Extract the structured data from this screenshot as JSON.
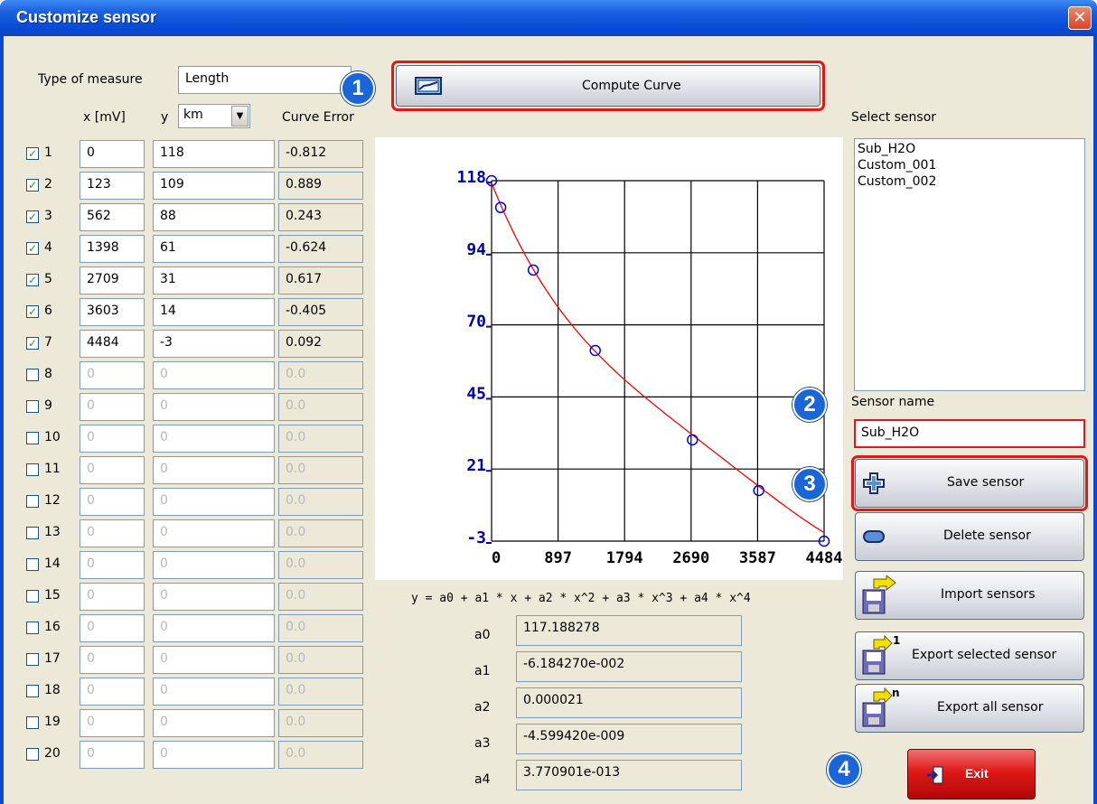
{
  "window": {
    "title": "Customize sensor",
    "close_glyph": "✕"
  },
  "measure": {
    "label": "Type of measure",
    "value": "Length"
  },
  "headers": {
    "x": "x [mV]",
    "y": "y",
    "unit": "km",
    "err": "Curve Error"
  },
  "rows": [
    {
      "n": "1",
      "checked": true,
      "x": "0",
      "y": "118",
      "err": "-0.812"
    },
    {
      "n": "2",
      "checked": true,
      "x": "123",
      "y": "109",
      "err": "0.889"
    },
    {
      "n": "3",
      "checked": true,
      "x": "562",
      "y": "88",
      "err": "0.243"
    },
    {
      "n": "4",
      "checked": true,
      "x": "1398",
      "y": "61",
      "err": "-0.624"
    },
    {
      "n": "5",
      "checked": true,
      "x": "2709",
      "y": "31",
      "err": "0.617"
    },
    {
      "n": "6",
      "checked": true,
      "x": "3603",
      "y": "14",
      "err": "-0.405"
    },
    {
      "n": "7",
      "checked": true,
      "x": "4484",
      "y": "-3",
      "err": "0.092"
    },
    {
      "n": "8",
      "checked": false,
      "x": "0",
      "y": "0",
      "err": "0.0"
    },
    {
      "n": "9",
      "checked": false,
      "x": "0",
      "y": "0",
      "err": "0.0"
    },
    {
      "n": "10",
      "checked": false,
      "x": "0",
      "y": "0",
      "err": "0.0"
    },
    {
      "n": "11",
      "checked": false,
      "x": "0",
      "y": "0",
      "err": "0.0"
    },
    {
      "n": "12",
      "checked": false,
      "x": "0",
      "y": "0",
      "err": "0.0"
    },
    {
      "n": "13",
      "checked": false,
      "x": "0",
      "y": "0",
      "err": "0.0"
    },
    {
      "n": "14",
      "checked": false,
      "x": "0",
      "y": "0",
      "err": "0.0"
    },
    {
      "n": "15",
      "checked": false,
      "x": "0",
      "y": "0",
      "err": "0.0"
    },
    {
      "n": "16",
      "checked": false,
      "x": "0",
      "y": "0",
      "err": "0.0"
    },
    {
      "n": "17",
      "checked": false,
      "x": "0",
      "y": "0",
      "err": "0.0"
    },
    {
      "n": "18",
      "checked": false,
      "x": "0",
      "y": "0",
      "err": "0.0"
    },
    {
      "n": "19",
      "checked": false,
      "x": "0",
      "y": "0",
      "err": "0.0"
    },
    {
      "n": "20",
      "checked": false,
      "x": "0",
      "y": "0",
      "err": "0.0"
    }
  ],
  "compute_button": {
    "label": "Compute Curve",
    "icon": "curve-chart-icon"
  },
  "badges": [
    "1",
    "2",
    "3",
    "4"
  ],
  "chart_data": {
    "type": "scatter",
    "x_ticks": [
      "0",
      "897",
      "1794",
      "2690",
      "3587",
      "4484"
    ],
    "y_ticks": [
      "118",
      "94",
      "70",
      "45",
      "21",
      "-3"
    ],
    "xlim": [
      0,
      4484
    ],
    "ylim": [
      -3,
      118
    ],
    "grid": true,
    "points": [
      [
        0,
        118
      ],
      [
        123,
        109
      ],
      [
        562,
        88
      ],
      [
        1398,
        61
      ],
      [
        2709,
        31
      ],
      [
        3603,
        14
      ],
      [
        4484,
        -3
      ]
    ],
    "point_color": "#0000ff",
    "curve_color": "#ff0000",
    "tick_color": "#0000aa",
    "formula": "y = a0 + a1 * x + a2 * x^2 + a3 * x^3 + a4 * x^4"
  },
  "coefficients": [
    {
      "name": "a0",
      "value": "117.188278"
    },
    {
      "name": "a1",
      "value": "-6.184270e-002"
    },
    {
      "name": "a2",
      "value": "0.000021"
    },
    {
      "name": "a3",
      "value": "-4.599420e-009"
    },
    {
      "name": "a4",
      "value": "3.770901e-013"
    }
  ],
  "sensors": {
    "label": "Select sensor",
    "items": [
      "Sub_H2O",
      "Custom_001",
      "Custom_002"
    ],
    "name_label": "Sensor name",
    "name_value": "Sub_H2O"
  },
  "buttons": {
    "save": "Save sensor",
    "delete": "Delete sensor",
    "import": "Import sensors",
    "export_selected": "Export selected sensor",
    "export_all": "Export all sensor",
    "exit": "Exit"
  },
  "colors": {
    "title_bar": "#0a4ed8",
    "client_bg": "#ece9d8",
    "highlight_frame": "#e01818",
    "badge": "#1a66d8",
    "exit_red": "#d01010"
  }
}
